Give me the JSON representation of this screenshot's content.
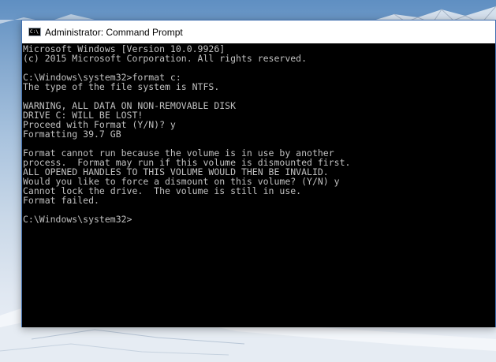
{
  "window": {
    "title": "Administrator: Command Prompt",
    "icon_label": "C:\\"
  },
  "console": {
    "lines": [
      "Microsoft Windows [Version 10.0.9926]",
      "(c) 2015 Microsoft Corporation. All rights reserved.",
      "",
      "C:\\Windows\\system32>format c:",
      "The type of the file system is NTFS.",
      "",
      "WARNING, ALL DATA ON NON-REMOVABLE DISK",
      "DRIVE C: WILL BE LOST!",
      "Proceed with Format (Y/N)? y",
      "Formatting 39.7 GB",
      "",
      "Format cannot run because the volume is in use by another",
      "process.  Format may run if this volume is dismounted first.",
      "ALL OPENED HANDLES TO THIS VOLUME WOULD THEN BE INVALID.",
      "Would you like to force a dismount on this volume? (Y/N) y",
      "Cannot lock the drive.  The volume is still in use.",
      "Format failed.",
      "",
      "C:\\Windows\\system32>"
    ]
  }
}
